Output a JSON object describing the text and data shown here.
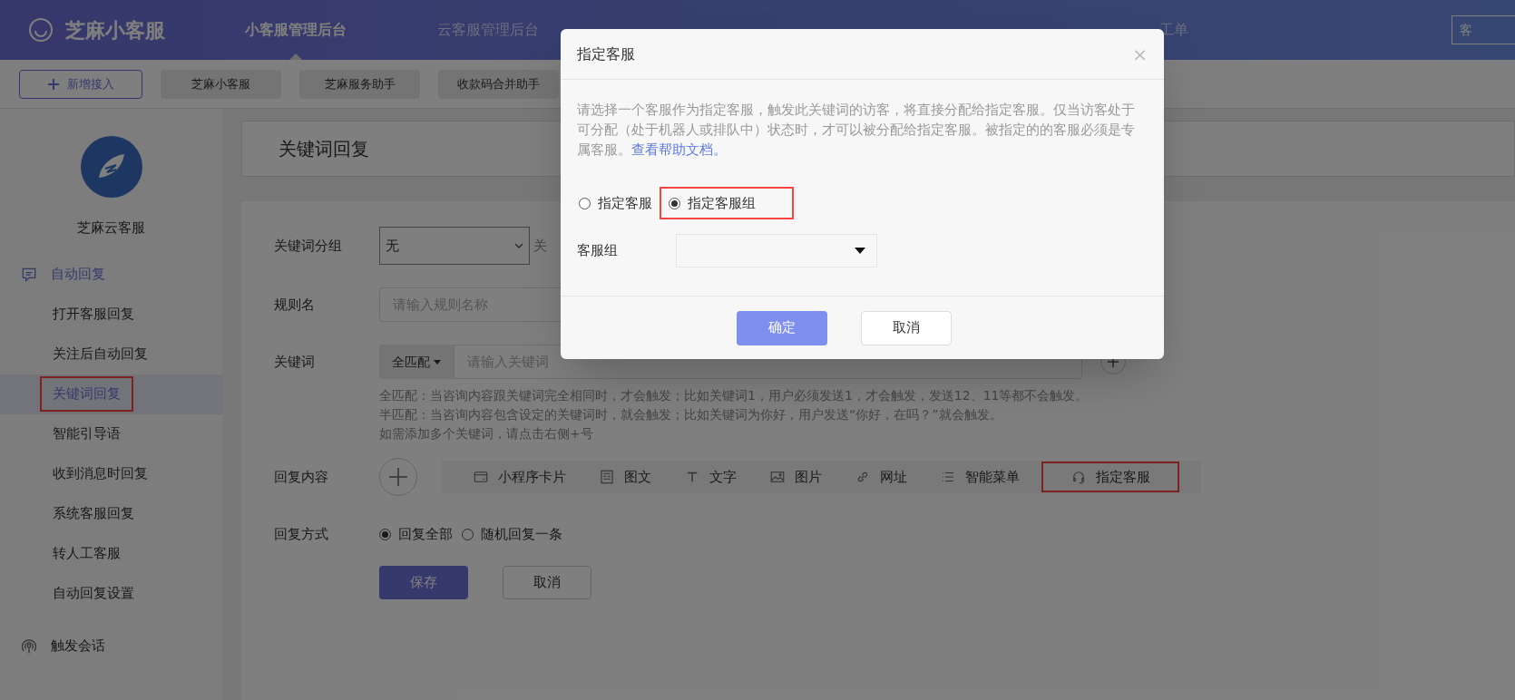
{
  "header": {
    "brand": "芝麻小客服",
    "nav": [
      {
        "label": "小客服管理后台",
        "selected": true
      },
      {
        "label": "云客服管理后台",
        "selected": false
      },
      {
        "label": "工单",
        "selected": false
      }
    ],
    "right_button": "客"
  },
  "subbar": {
    "add_button": "新增接入",
    "apps": [
      "芝麻小客服",
      "芝麻服务助手",
      "收款码合并助手"
    ]
  },
  "sidebar": {
    "account": "芝麻云客服",
    "groups": [
      {
        "label": "自动回复",
        "kind": "chat",
        "expanded": true,
        "items": [
          {
            "label": "打开客服回复",
            "selected": false,
            "highlighted": false
          },
          {
            "label": "关注后自动回复",
            "selected": false,
            "highlighted": false
          },
          {
            "label": "关键词回复",
            "selected": true,
            "highlighted": true
          },
          {
            "label": "智能引导语",
            "selected": false,
            "highlighted": false
          },
          {
            "label": "收到消息时回复",
            "selected": false,
            "highlighted": false
          },
          {
            "label": "系统客服回复",
            "selected": false,
            "highlighted": false
          },
          {
            "label": "转人工客服",
            "selected": false,
            "highlighted": false
          },
          {
            "label": "自动回复设置",
            "selected": false,
            "highlighted": false
          }
        ]
      },
      {
        "label": "触发会话",
        "kind": "signal",
        "expanded": false
      }
    ]
  },
  "page": {
    "title": "关键词回复",
    "form": {
      "group_label": "关键词分组",
      "group_value": "无",
      "group_side_text": "关",
      "rule_label": "规则名",
      "rule_placeholder": "请输入规则名称",
      "keyword_label": "关键词",
      "match_mode": "全匹配",
      "keyword_placeholder": "请输入关键词",
      "hints": [
        "全匹配：当咨询内容跟关键词完全相同时，才会触发；比如关键词1，用户必须发送1，才会触发，发送12、11等都不会触发。",
        "半匹配：当咨询内容包含设定的关键词时，就会触发；比如关键词为你好，用户发送“你好，在吗？”就会触发。",
        "如需添加多个关键词，请点击右侧+号"
      ],
      "content_label": "回复内容",
      "content_types": [
        {
          "kind": "card",
          "label": "小程序卡片",
          "highlighted": false
        },
        {
          "kind": "article",
          "label": "图文",
          "highlighted": false
        },
        {
          "kind": "text",
          "label": "文字",
          "highlighted": false
        },
        {
          "kind": "image",
          "label": "图片",
          "highlighted": false
        },
        {
          "kind": "link",
          "label": "网址",
          "highlighted": false
        },
        {
          "kind": "list",
          "label": "智能菜单",
          "highlighted": false
        },
        {
          "kind": "headset",
          "label": "指定客服",
          "highlighted": true
        }
      ],
      "mode_label": "回复方式",
      "modes": [
        {
          "label": "回复全部",
          "selected": true
        },
        {
          "label": "随机回复一条",
          "selected": false
        }
      ],
      "save": "保存",
      "cancel": "取消"
    }
  },
  "dialog": {
    "title": "指定客服",
    "close": "×",
    "description": "请选择一个客服作为指定客服，触发此关键词的访客，将直接分配给指定客服。仅当访客处于可分配（处于机器人或排队中）状态时，才可以被分配给指定客服。被指定的的客服必须是专属客服。",
    "help_link": "查看帮助文档。",
    "options": [
      {
        "label": "指定客服",
        "selected": false,
        "highlighted": false
      },
      {
        "label": "指定客服组",
        "selected": true,
        "highlighted": true
      }
    ],
    "group_label": "客服组",
    "confirm": "确定",
    "cancel": "取消"
  }
}
